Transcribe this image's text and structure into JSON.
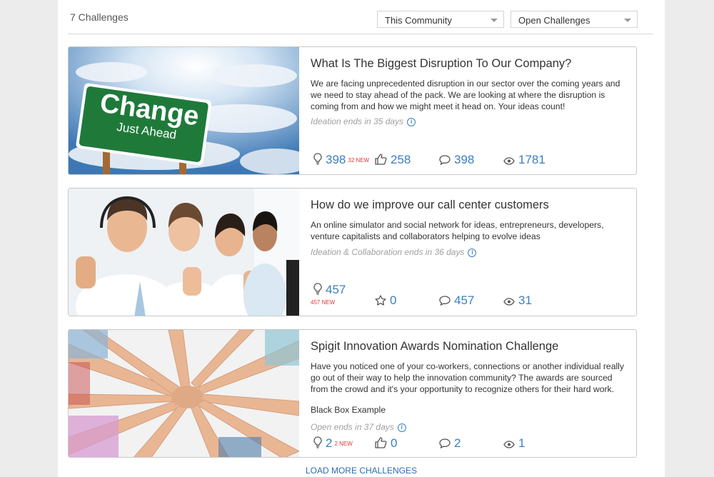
{
  "header": {
    "count": "7 Challenges",
    "filter_community": "This Community",
    "filter_status": "Open Challenges"
  },
  "cards": [
    {
      "title": "What Is The Biggest Disruption To Our Company?",
      "description": "We are facing unprecedented disruption in our sector over the coming years and we need to stay ahead of the pack. We are looking at where the disruption is coming from and how we might meet it head on. Your ideas count!",
      "ends": "Ideation ends in 35 days",
      "image_text_1": "Change",
      "image_text_2": "Just Ahead",
      "ideas": "398",
      "ideas_new": "32 NEW",
      "likes": "258",
      "comments": "398",
      "views": "1781"
    },
    {
      "title": "How do we improve our call center customers",
      "description": "An online simulator and social network for ideas, entrepreneurs, developers, venture capitalists and collaborators helping to evolve ideas",
      "ends": "Ideation & Collaboration ends in 36 days",
      "ideas": "457",
      "ideas_new": "457 NEW",
      "likes": "0",
      "comments": "457",
      "views": "31"
    },
    {
      "title": "Spigit Innovation Awards Nomination Challenge",
      "description": "Have you noticed one of your co-workers, connections or another individual really go out of their way to help the innovation community? The awards are sourced from the crowd and it's your opportunity to recognize others for their hard work.",
      "extra": "Black Box Example",
      "ends": "Open ends in 37 days",
      "ideas": "2",
      "ideas_new": "2 NEW",
      "likes": "0",
      "comments": "2",
      "views": "1"
    }
  ],
  "footer": {
    "load_more": "LOAD MORE CHALLENGES"
  },
  "icons": {
    "idea": "lightbulb-icon",
    "like": "thumbs-up-icon",
    "favorite": "star-icon",
    "comment": "comment-icon",
    "view": "eye-icon",
    "info": "info-icon",
    "dropdown": "chevron-down-icon"
  },
  "colors": {
    "accent": "#3a7fc4",
    "new_badge": "#e53935",
    "link": "#2d6cb4"
  }
}
